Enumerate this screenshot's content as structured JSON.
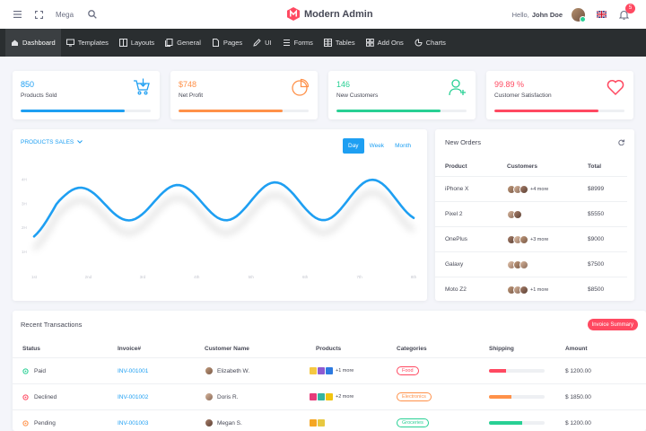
{
  "topbar": {
    "mega": "Mega",
    "brand": "Modern Admin",
    "hello": "Hello,",
    "user": "John Doe",
    "notif_count": "5",
    "brand_color": "#ff4961"
  },
  "nav": [
    {
      "label": "Dashboard",
      "icon": "home-icon",
      "active": true
    },
    {
      "label": "Templates",
      "icon": "monitor-icon"
    },
    {
      "label": "Layouts",
      "icon": "columns-icon"
    },
    {
      "label": "General",
      "icon": "copy-icon"
    },
    {
      "label": "Pages",
      "icon": "file-icon"
    },
    {
      "label": "UI",
      "icon": "pencil-icon"
    },
    {
      "label": "Forms",
      "icon": "forms-icon"
    },
    {
      "label": "Tables",
      "icon": "table-icon"
    },
    {
      "label": "Add Ons",
      "icon": "layers-icon"
    },
    {
      "label": "Charts",
      "icon": "pie-icon"
    }
  ],
  "stats": [
    {
      "value": "850",
      "label": "Products Sold",
      "color": "#1e9ff2",
      "progress": 0.8,
      "icon": "cart-icon"
    },
    {
      "value": "$748",
      "label": "Net Profit",
      "color": "#ff9149",
      "progress": 0.8,
      "icon": "pie-chart-icon"
    },
    {
      "value": "146",
      "label": "New Customers",
      "color": "#28d094",
      "progress": 0.8,
      "icon": "user-add-icon"
    },
    {
      "value": "99.89 %",
      "label": "Customer Satisfaction",
      "color": "#ff4961",
      "progress": 0.8,
      "icon": "heart-icon"
    }
  ],
  "sales": {
    "title": "PRODUCTS SALES",
    "tabs": [
      "Day",
      "Week",
      "Month"
    ],
    "active_tab": "Day"
  },
  "chart_data": {
    "type": "line",
    "x": [
      "1st",
      "2nd",
      "3rd",
      "4th",
      "5th",
      "6th",
      "7th",
      "8th"
    ],
    "yticks": [
      "1H",
      "2H",
      "3H",
      "4H"
    ],
    "title": "",
    "color": "#1e9ff2"
  },
  "orders": {
    "title": "New Orders",
    "headers": [
      "Product",
      "Customers",
      "Total"
    ],
    "rows": [
      {
        "product": "iPhone X",
        "more": "+4 more",
        "total": "$8999",
        "avatars": 3
      },
      {
        "product": "Pixel 2",
        "more": "",
        "total": "$5550",
        "avatars": 2
      },
      {
        "product": "OnePlus",
        "more": "+3 more",
        "total": "$9000",
        "avatars": 3
      },
      {
        "product": "Galaxy",
        "more": "",
        "total": "$7500",
        "avatars": 3
      },
      {
        "product": "Moto Z2",
        "more": "+1 more",
        "total": "$8500",
        "avatars": 3
      }
    ]
  },
  "transactions": {
    "title": "Recent Transactions",
    "button": "Invoice Summary",
    "headers": [
      "Status",
      "Invoice#",
      "Customer Name",
      "Products",
      "Categories",
      "Shipping",
      "Amount"
    ],
    "rows": [
      {
        "status": "Paid",
        "status_color": "#28d094",
        "invoice": "INV-001001",
        "customer": "Elizabeth W.",
        "more": "+1 more",
        "category": "Food",
        "cat_color": "#ff4961",
        "ship": 0.3,
        "ship_color": "#ff4961",
        "amount": "$ 1200.00"
      },
      {
        "status": "Declined",
        "status_color": "#ff4961",
        "invoice": "INV-001002",
        "customer": "Doris R.",
        "more": "+2 more",
        "category": "Electronics",
        "cat_color": "#ff9149",
        "ship": 0.4,
        "ship_color": "#ff9149",
        "amount": "$ 1850.00"
      },
      {
        "status": "Pending",
        "status_color": "#ff9149",
        "invoice": "INV-001003",
        "customer": "Megan S.",
        "more": "",
        "category": "Groceries",
        "cat_color": "#28d094",
        "ship": 0.6,
        "ship_color": "#28d094",
        "amount": "$ 1200.00"
      }
    ]
  }
}
